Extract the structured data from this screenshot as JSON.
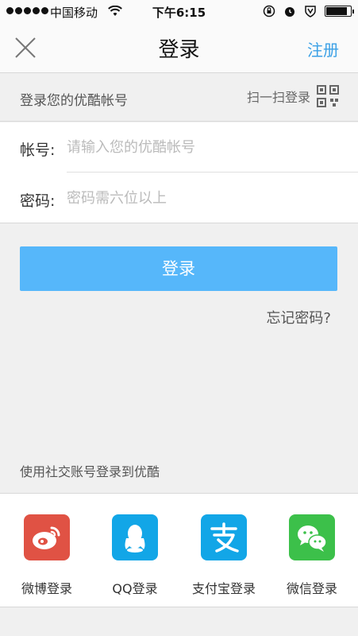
{
  "status_bar": {
    "carrier": "中国移动",
    "time": "下午6:15",
    "battery_level": 0.9
  },
  "nav": {
    "title": "登录",
    "register_label": "注册"
  },
  "subheader": {
    "label": "登录您的优酷帐号",
    "scan_label": "扫一扫登录"
  },
  "form": {
    "account_label": "帐号:",
    "account_placeholder": "请输入您的优酷帐号",
    "password_label": "密码:",
    "password_placeholder": "密码需六位以上"
  },
  "login_button": "登录",
  "forgot_password": "忘记密码?",
  "social": {
    "title": "使用社交账号登录到优酷",
    "items": [
      {
        "label": "微博登录",
        "icon": "weibo-icon",
        "color": "#e05244"
      },
      {
        "label": "QQ登录",
        "icon": "qq-icon",
        "color": "#12a6e7"
      },
      {
        "label": "支付宝登录",
        "icon": "alipay-icon",
        "color": "#12a6e7"
      },
      {
        "label": "微信登录",
        "icon": "wechat-icon",
        "color": "#3cc04a"
      }
    ]
  },
  "colors": {
    "accent": "#3aa0e6",
    "button": "#56b7fa"
  }
}
